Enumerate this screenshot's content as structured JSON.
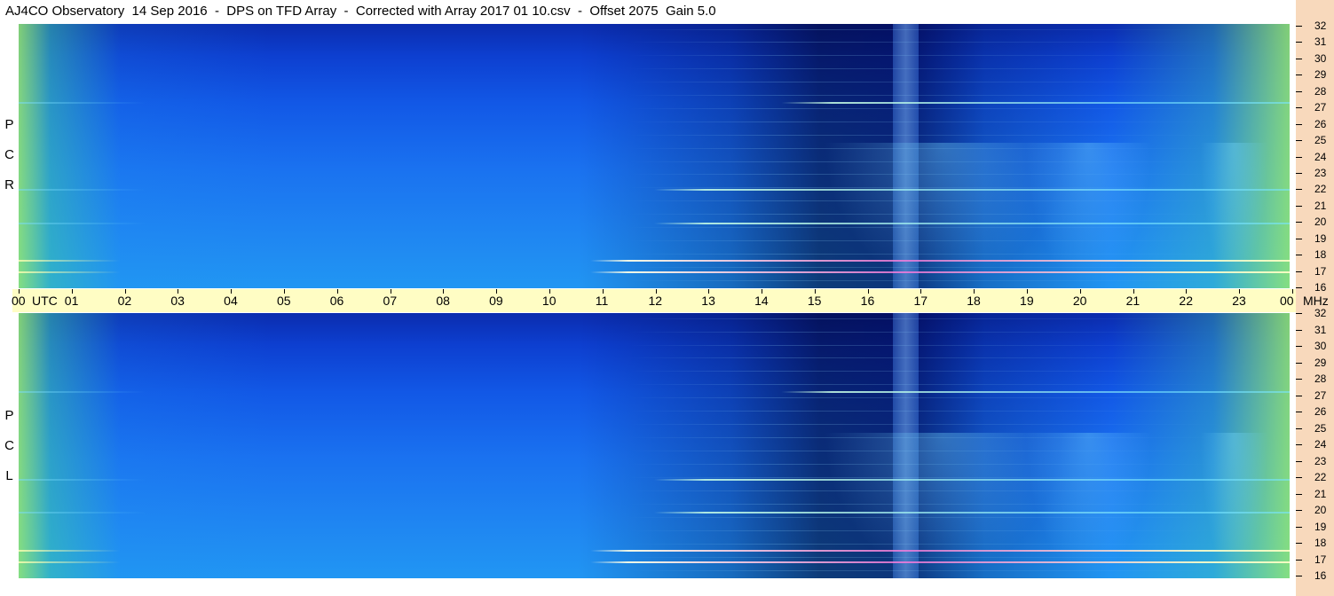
{
  "title": "AJ4CO Observatory  14 Sep 2016  -  DPS on TFD Array  -  Corrected with Array 2017 01 10.csv  -  Offset 2075  Gain 5.0",
  "colors": {
    "background": "#ffffff",
    "utc_bar": "#fffdc4",
    "side_strip": "#f8d9bc",
    "spectrogram_low": "#0b2cae",
    "spectrogram_mid": "#1a72f0",
    "spectrogram_high": "#95eb6e"
  },
  "chart_data": {
    "type": "heatmap",
    "x_axis": {
      "unit_label": "UTC",
      "range": [
        0,
        24
      ],
      "tick_labels": [
        "00",
        "01",
        "02",
        "03",
        "04",
        "05",
        "06",
        "07",
        "08",
        "09",
        "10",
        "11",
        "12",
        "13",
        "14",
        "15",
        "16",
        "17",
        "18",
        "19",
        "20",
        "21",
        "22",
        "23",
        "00"
      ]
    },
    "y_axis": {
      "unit_label": "MHz",
      "range": [
        16,
        32
      ],
      "tick_labels": [
        "32",
        "31",
        "30",
        "29",
        "28",
        "27",
        "26",
        "25",
        "24",
        "23",
        "22",
        "21",
        "20",
        "19",
        "18",
        "17",
        "16"
      ]
    },
    "panels": [
      {
        "polarization": "RCP",
        "label_letters": [
          "P",
          "C",
          "R"
        ]
      },
      {
        "polarization": "LCP",
        "label_letters": [
          "P",
          "C",
          "L"
        ]
      }
    ],
    "colormap": [
      "dark blue",
      "blue",
      "cyan",
      "green",
      "yellow",
      "white",
      "magenta"
    ],
    "features": {
      "persistent_interference_mhz": [
        17.0,
        17.7,
        20.0,
        22.0,
        27.3
      ],
      "daytime_absorption_utc": [
        14,
        17
      ],
      "strong_broadband_utc": [
        16.5,
        17.0
      ]
    }
  }
}
